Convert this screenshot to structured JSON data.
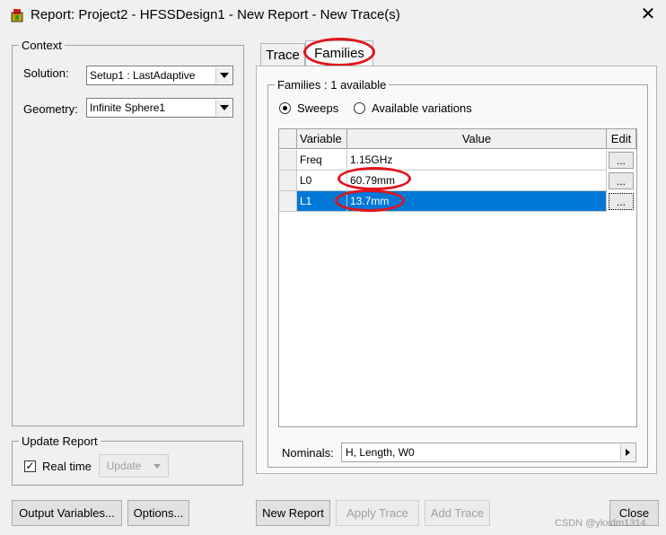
{
  "window": {
    "title": "Report: Project2 - HFSSDesign1 - New Report - New Trace(s)",
    "close_glyph": "✕"
  },
  "context": {
    "label": "Context",
    "solution_label": "Solution:",
    "solution_value": "Setup1 : LastAdaptive",
    "geometry_label": "Geometry:",
    "geometry_value": "Infinite Sphere1"
  },
  "update_report": {
    "label": "Update Report",
    "realtime_label": "Real time",
    "realtime_checked": true,
    "update_button": "Update"
  },
  "tabs": [
    {
      "label": "Trace",
      "active": false
    },
    {
      "label": "Families",
      "active": true
    }
  ],
  "families": {
    "group_label": "Families : 1 available",
    "radio_sweeps": "Sweeps",
    "radio_variations": "Available variations",
    "selected_mode": "Sweeps",
    "columns": [
      "Variable",
      "Value",
      "Edit"
    ],
    "rows": [
      {
        "variable": "Freq",
        "value": "1.15GHz",
        "edit": "..."
      },
      {
        "variable": "L0",
        "value": "60.79mm",
        "edit": "..."
      },
      {
        "variable": "L1",
        "value": "13.7mm",
        "edit": "...",
        "selected": true
      }
    ],
    "nominals_label": "Nominals:",
    "nominals_value": "H, Length, W0"
  },
  "buttons": {
    "output_variables": "Output Variables...",
    "options": "Options...",
    "new_report": "New Report",
    "apply_trace": "Apply Trace",
    "add_trace": "Add Trace",
    "close": "Close"
  },
  "watermark": "CSDN @ykxdm1314",
  "colors": {
    "selection": "#0078d7",
    "annotation_ring": "#e0141c",
    "window_bg": "#f0f0f0"
  }
}
